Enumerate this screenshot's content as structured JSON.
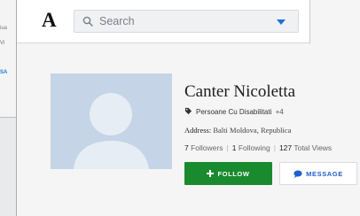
{
  "background_page": {
    "lines": [
      "iua",
      "Vi",
      "SA"
    ]
  },
  "header": {
    "logo": "A",
    "search": {
      "placeholder": "Search"
    }
  },
  "profile": {
    "name": "Canter Nicoletta",
    "category": "Persoane Cu Disabilitati",
    "category_more": "+4",
    "address_label": "Address:",
    "address_value": "Balti Moldova, Republica",
    "followers_count": "7",
    "followers_label": "Followers",
    "following_count": "1",
    "following_label": "Following",
    "views_count": "127",
    "views_label": "Total Views",
    "follow_button": "FOLLOW",
    "message_button": "MESSAGE"
  },
  "colors": {
    "follow_bg": "#1a8a2e",
    "message_text": "#1e5fc9",
    "avatar_bg": "#c5d4e6"
  },
  "icons": {
    "search": "search-icon",
    "dropdown": "chevron-down-icon",
    "tag": "tag-icon",
    "plus": "plus-icon",
    "chat": "chat-bubble-icon"
  }
}
